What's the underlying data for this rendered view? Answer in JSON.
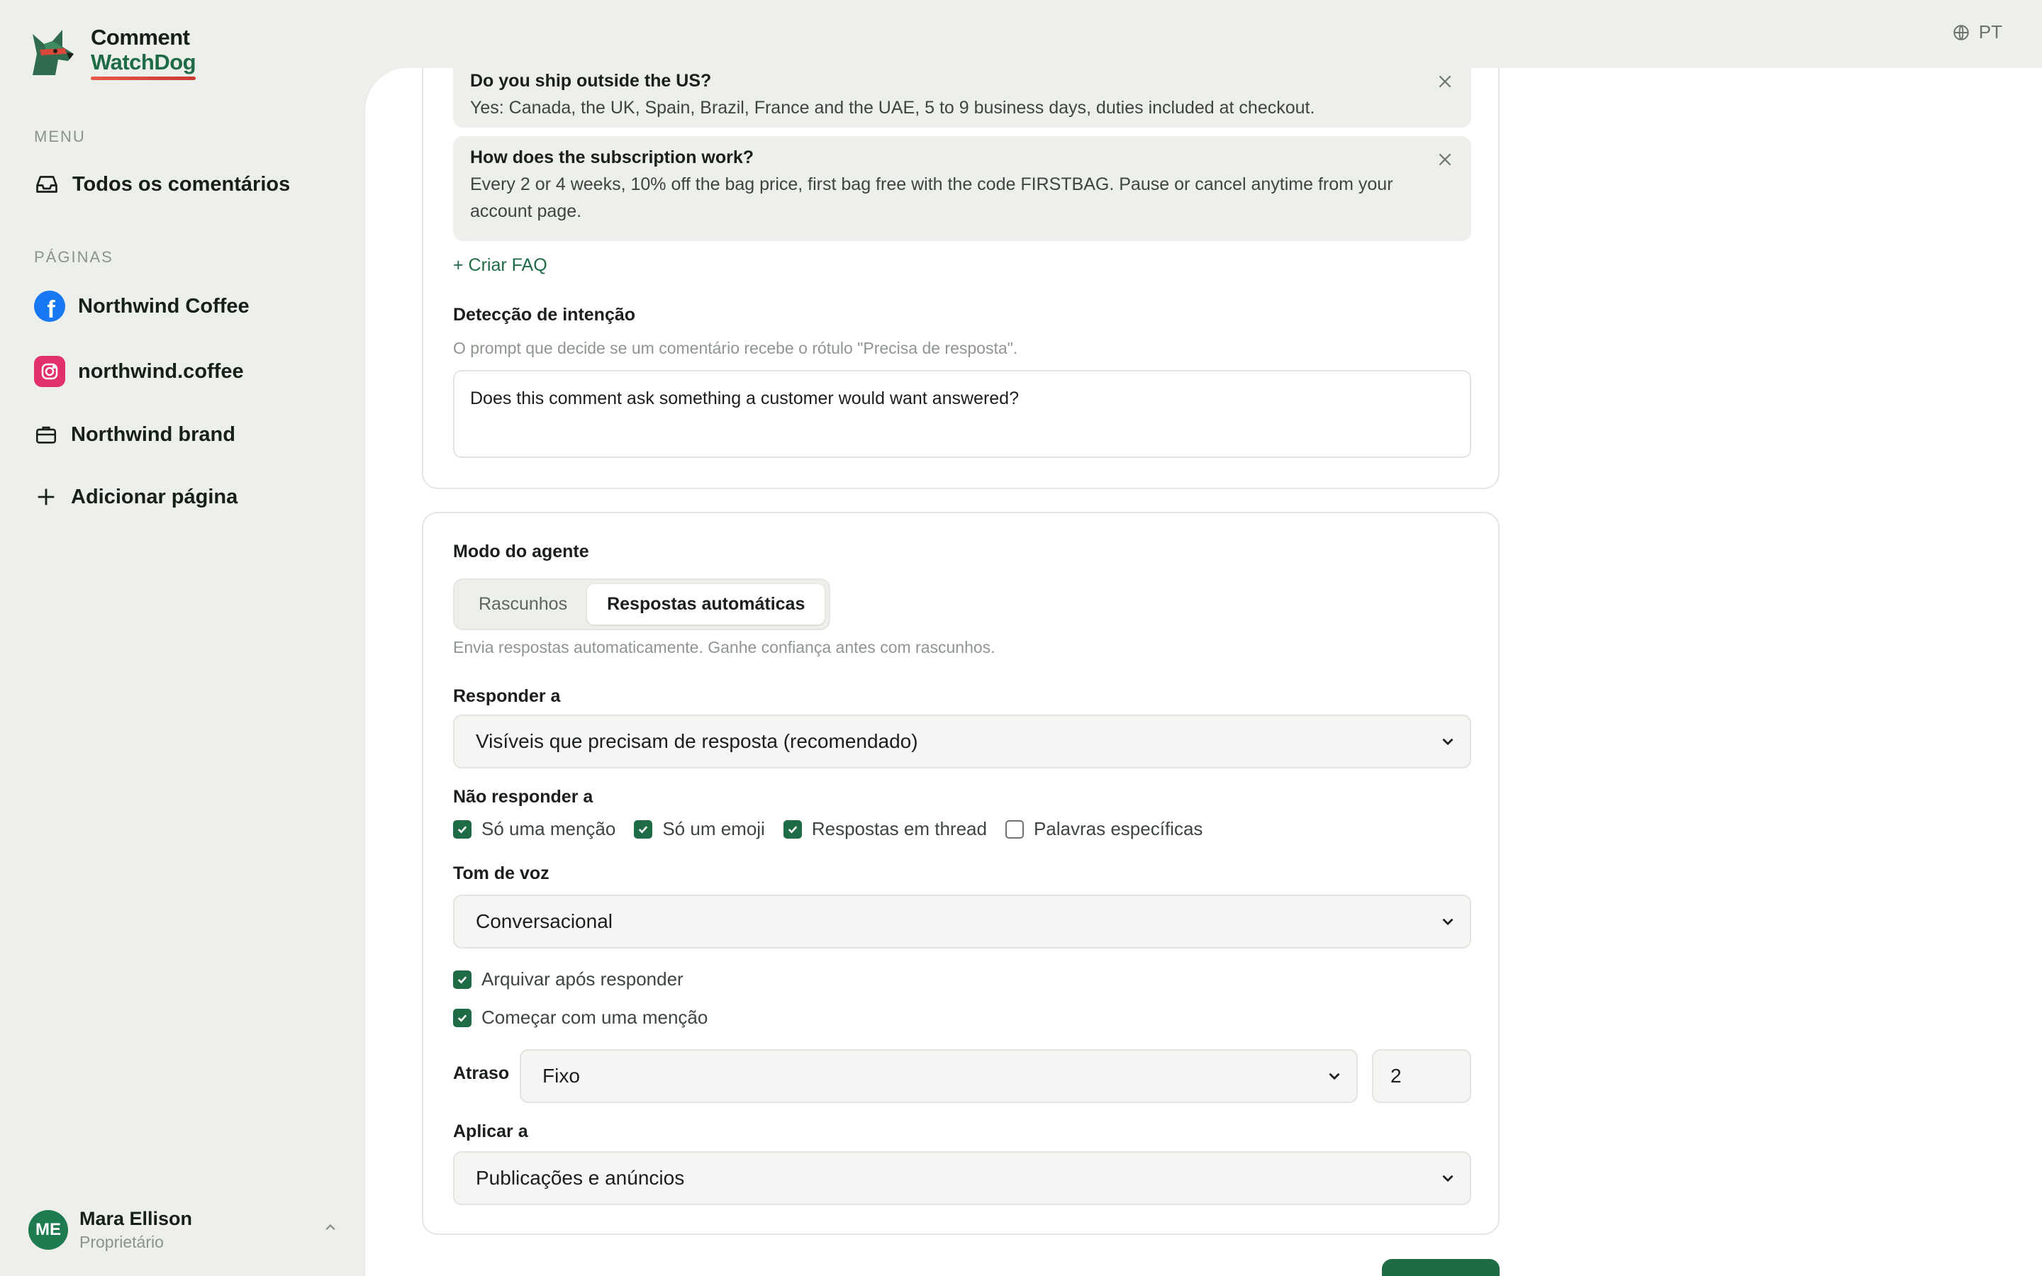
{
  "app": {
    "logo_line1": "Comment",
    "logo_line2": "WatchDog",
    "language": "PT"
  },
  "sidebar": {
    "menu_label": "MENU",
    "all_comments": "Todos os comentários",
    "pages_label": "PÁGINAS",
    "pages": [
      {
        "label": "Northwind Coffee",
        "icon": "facebook-icon"
      },
      {
        "label": "northwind.coffee",
        "icon": "instagram-icon"
      },
      {
        "label": "Northwind brand",
        "icon": "briefcase-icon"
      }
    ],
    "add_page": "Adicionar página"
  },
  "user": {
    "initials": "ME",
    "name": "Mara Ellison",
    "role": "Proprietário"
  },
  "faqs": [
    {
      "question": "Do you ship outside the US?",
      "answer": "Yes: Canada, the UK, Spain, Brazil, France and the UAE, 5 to 9 business days, duties included at checkout."
    },
    {
      "question": "How does the subscription work?",
      "answer": "Every 2 or 4 weeks, 10% off the bag price, first bag free with the code FIRSTBAG. Pause or cancel anytime from your account page."
    }
  ],
  "create_faq": "+ Criar FAQ",
  "intent": {
    "label": "Detecção de intenção",
    "hint": "O prompt que decide se um comentário recebe o rótulo \"Precisa de resposta\".",
    "value": "Does this comment ask something a customer would want answered?"
  },
  "agent": {
    "mode_label": "Modo do agente",
    "modes": [
      "Rascunhos",
      "Respostas automáticas"
    ],
    "active_mode": "Respostas automáticas",
    "mode_hint": "Envia respostas automaticamente. Ganhe confiança antes com rascunhos.",
    "reply_to_label": "Responder a",
    "reply_to_value": "Visíveis que precisam de resposta (recomendado)",
    "dont_reply_label": "Não responder a",
    "dont_reply": [
      {
        "label": "Só uma menção",
        "checked": true
      },
      {
        "label": "Só um emoji",
        "checked": true
      },
      {
        "label": "Respostas em thread",
        "checked": true
      },
      {
        "label": "Palavras específicas",
        "checked": false
      }
    ],
    "tone_label": "Tom de voz",
    "tone_value": "Conversacional",
    "archive_label": "Arquivar após responder",
    "archive_checked": true,
    "mention_label": "Começar com uma menção",
    "mention_checked": true,
    "delay_label": "Atraso",
    "delay_type": "Fixo",
    "delay_value": "2",
    "apply_label": "Aplicar a",
    "apply_value": "Publicações e anúncios"
  },
  "colors": {
    "accent": "#1e6b45",
    "sidebar_bg": "#edefea",
    "facebook": "#1877f2",
    "instagram": "#e1306c"
  }
}
